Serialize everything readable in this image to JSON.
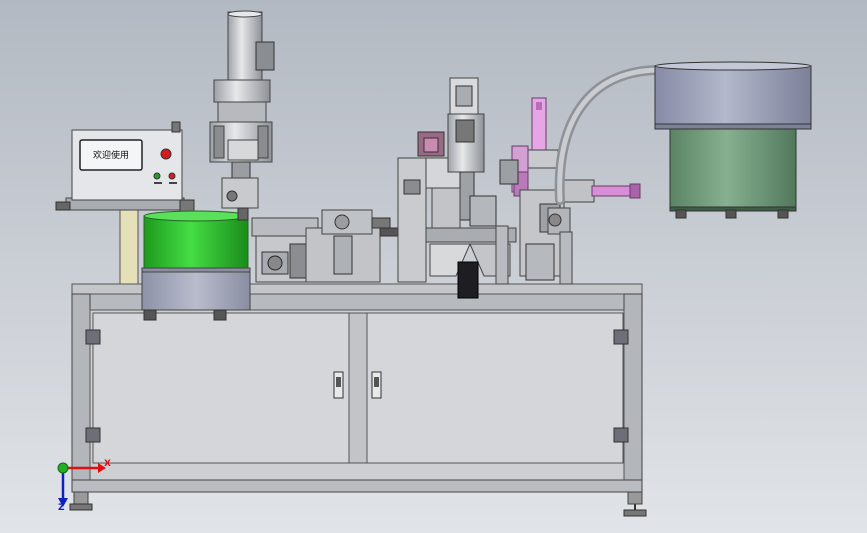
{
  "hmi": {
    "screen_text": "欢迎使用"
  },
  "axes": {
    "x_label": "X",
    "z_label": "Z"
  },
  "colors": {
    "background_top": "#b8bec6",
    "background_bottom": "#dfe2e6",
    "cabinet": "#cfd1d4",
    "frame": "#b0b3b8",
    "green_hopper": "#2ec02e",
    "bowl_top": "#9a9fb8",
    "bowl_bottom": "#6e9878",
    "pink_cylinder": "#d88ad8",
    "hmi_box": "#e4e6ea"
  },
  "icons": {
    "triad": "coordinate-triad-icon",
    "handle": "cabinet-handle-icon"
  }
}
